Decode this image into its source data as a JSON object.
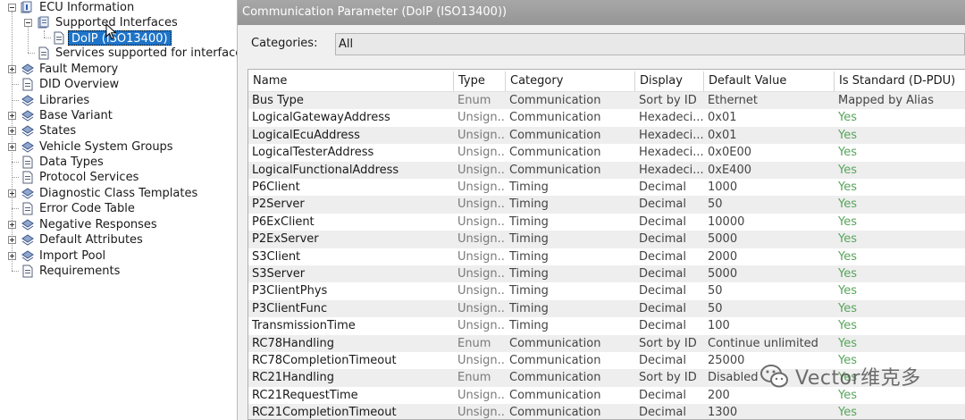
{
  "tree": {
    "items": [
      {
        "label": "ECU Information",
        "icon": "folder-info-icon",
        "expander": "minus"
      },
      {
        "label": "Supported Interfaces",
        "icon": "interfaces-icon",
        "expander": "minus"
      },
      {
        "label": "DoIP (ISO13400)",
        "icon": "document-icon",
        "selected": true
      },
      {
        "label": "Services supported for interfaces",
        "icon": "document-icon"
      },
      {
        "label": "Fault Memory",
        "icon": "diamond-stack-icon",
        "expander": "plus"
      },
      {
        "label": "DID Overview",
        "icon": "document-icon"
      },
      {
        "label": "Libraries",
        "icon": "diamond-stack-icon"
      },
      {
        "label": "Base Variant",
        "icon": "diamond-stack-icon",
        "expander": "plus"
      },
      {
        "label": "States",
        "icon": "diamond-stack-icon",
        "expander": "plus"
      },
      {
        "label": "Vehicle System Groups",
        "icon": "diamond-stack-icon",
        "expander": "plus"
      },
      {
        "label": "Data Types",
        "icon": "document-icon"
      },
      {
        "label": "Protocol Services",
        "icon": "document-icon"
      },
      {
        "label": "Diagnostic Class Templates",
        "icon": "diamond-stack-icon",
        "expander": "plus"
      },
      {
        "label": "Error Code Table",
        "icon": "document-icon"
      },
      {
        "label": "Negative Responses",
        "icon": "diamond-stack-icon",
        "expander": "plus"
      },
      {
        "label": "Default Attributes",
        "icon": "diamond-stack-icon",
        "expander": "plus"
      },
      {
        "label": "Import Pool",
        "icon": "diamond-stack-icon",
        "expander": "plus"
      },
      {
        "label": "Requirements",
        "icon": "document-icon"
      }
    ]
  },
  "panel": {
    "title": "Communication Parameter (DoIP (ISO13400))",
    "categories_label": "Categories:",
    "categories_value": "All"
  },
  "table": {
    "columns": [
      "Name",
      "Type",
      "Category",
      "Display",
      "Default Value",
      "Is Standard (D-PDU)"
    ],
    "rows": [
      [
        "Bus Type",
        "Enum",
        "Communication",
        "Sort by ID",
        "Ethernet",
        "Mapped by Alias"
      ],
      [
        "LogicalGatewayAddress",
        "Unsign...",
        "Communication",
        "Hexadeci...",
        "0x01",
        "Yes"
      ],
      [
        "LogicalEcuAddress",
        "Unsign...",
        "Communication",
        "Hexadeci...",
        "0x01",
        "Yes"
      ],
      [
        "LogicalTesterAddress",
        "Unsign...",
        "Communication",
        "Hexadeci...",
        "0x0E00",
        "Yes"
      ],
      [
        "LogicalFunctionalAddress",
        "Unsign...",
        "Communication",
        "Hexadeci...",
        "0xE400",
        "Yes"
      ],
      [
        "P6Client",
        "Unsign...",
        "Timing",
        "Decimal",
        "1000",
        "Yes"
      ],
      [
        "P2Server",
        "Unsign...",
        "Timing",
        "Decimal",
        "50",
        "Yes"
      ],
      [
        "P6ExClient",
        "Unsign...",
        "Timing",
        "Decimal",
        "10000",
        "Yes"
      ],
      [
        "P2ExServer",
        "Unsign...",
        "Timing",
        "Decimal",
        "5000",
        "Yes"
      ],
      [
        "S3Client",
        "Unsign...",
        "Timing",
        "Decimal",
        "2000",
        "Yes"
      ],
      [
        "S3Server",
        "Unsign...",
        "Timing",
        "Decimal",
        "5000",
        "Yes"
      ],
      [
        "P3ClientPhys",
        "Unsign...",
        "Timing",
        "Decimal",
        "50",
        "Yes"
      ],
      [
        "P3ClientFunc",
        "Unsign...",
        "Timing",
        "Decimal",
        "50",
        "Yes"
      ],
      [
        "TransmissionTime",
        "Unsign...",
        "Timing",
        "Decimal",
        "100",
        "Yes"
      ],
      [
        "RC78Handling",
        "Enum",
        "Communication",
        "Sort by ID",
        "Continue unlimited",
        "Yes"
      ],
      [
        "RC78CompletionTimeout",
        "Unsign...",
        "Communication",
        "Decimal",
        "25000",
        "Yes"
      ],
      [
        "RC21Handling",
        "Enum",
        "Communication",
        "Sort by ID",
        "Disabled",
        "Yes"
      ],
      [
        "RC21RequestTime",
        "Unsign...",
        "Communication",
        "Decimal",
        "200",
        "Yes"
      ],
      [
        "RC21CompletionTimeout",
        "Unsign...",
        "Communication",
        "Decimal",
        "1300",
        "Yes"
      ]
    ]
  },
  "watermark": {
    "text": "Vector维克多",
    "icon": "wechat-icon"
  },
  "colors": {
    "selection": "#1e74c8",
    "yes_text": "#57a55a",
    "title_bar": "#a0a0a0"
  }
}
